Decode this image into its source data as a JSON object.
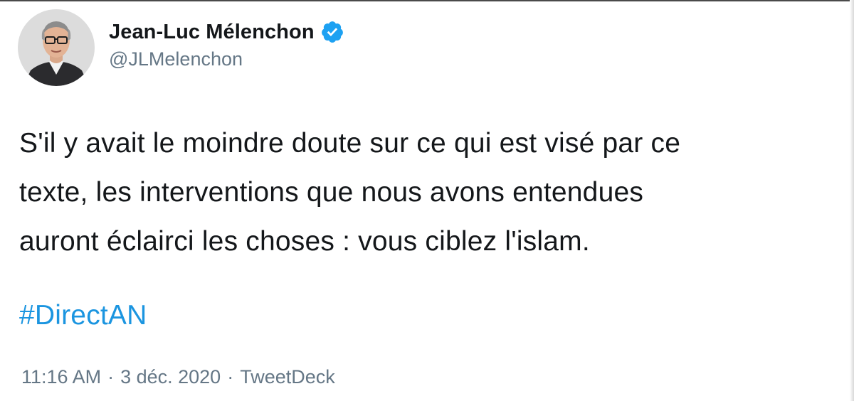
{
  "author": {
    "display_name": "Jean-Luc Mélenchon",
    "handle": "@JLMelenchon",
    "verified": true,
    "avatar_icon": "profile-photo",
    "verified_icon": "verified-badge-icon"
  },
  "tweet": {
    "text_lines": [
      "S'il y avait le moindre doute sur ce qui est visé par ce",
      "texte, les interventions que nous avons entendues",
      "auront éclairci les choses : vous ciblez l'islam."
    ],
    "hashtag": "#DirectAN"
  },
  "meta": {
    "time": "11:16 AM",
    "separator": "·",
    "date": "3 déc. 2020",
    "source": "TweetDeck"
  },
  "colors": {
    "text": "#14171a",
    "secondary": "#657786",
    "link": "#1b95e0",
    "verified": "#1da1f2"
  }
}
